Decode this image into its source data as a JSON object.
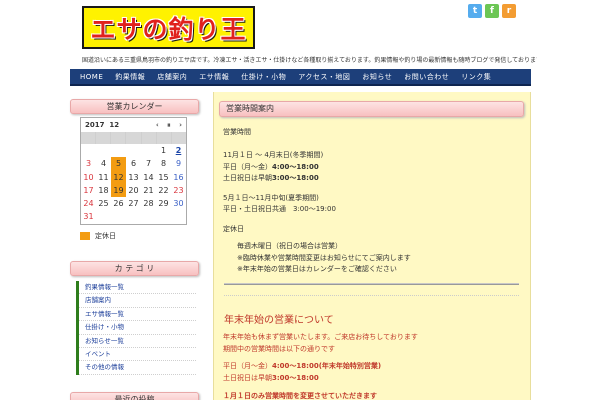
{
  "header": {
    "logo_text": "エサの釣り王",
    "description": "国道沿いにある三重県鳥羽市の釣りエサ店です。冷凍エサ・活きエサ・仕掛けなど各種取り揃えております。釣果情報や釣り場の最新情報も随時ブログで発信しておりますので、お気軽にご来店ください。営業時間や定休日はカレンダーでご確認いただけます。"
  },
  "social": {
    "twitter": "t",
    "feedly": "f",
    "rss": "r"
  },
  "nav": [
    "HOME",
    "釣果情報",
    "店舗案内",
    "エサ情報",
    "仕掛け・小物",
    "アクセス・地図",
    "お知らせ",
    "お問い合わせ",
    "リンク集"
  ],
  "sidebar": {
    "calendar_title": "営業カレンダー",
    "calendar": {
      "year": "2017",
      "month": "12",
      "prev": "‹",
      "today_btn": "⏸",
      "next": "›",
      "rows": [
        [
          "",
          "",
          "",
          "",
          "",
          "1",
          "2"
        ],
        [
          "3",
          "4",
          "5",
          "6",
          "7",
          "8",
          "9"
        ],
        [
          "10",
          "11",
          "12",
          "13",
          "14",
          "15",
          "16"
        ],
        [
          "17",
          "18",
          "19",
          "20",
          "21",
          "22",
          "23"
        ],
        [
          "24",
          "25",
          "26",
          "27",
          "28",
          "29",
          "30"
        ],
        [
          "31",
          "",
          "",
          "",
          "",
          "",
          ""
        ]
      ]
    },
    "legend": "定休日",
    "category_title": "カ テ ゴ リ",
    "categories": [
      "釣果情報一覧",
      "店舗案内",
      "エサ情報一覧",
      "仕掛け・小物",
      "お知らせ一覧",
      "イベント",
      "その他の情報"
    ],
    "next_title": "最近の投稿"
  },
  "main": {
    "title": "営業時間案内",
    "hours_label": "営業時間",
    "period1": "11月１日 ～ 4月末日(冬季期間)",
    "weekday1_a": "平日（月～金）",
    "weekday1_b": "4:00～18:00",
    "weekend1_a": "土日祝日は早朝",
    "weekend1_b": "3:00～18:00",
    "period2": "5月１日～11月中旬(夏季期間)",
    "weekday2": "平日・土日祝日共通　3:00～19:00",
    "closed_label": "定休日",
    "closed": "毎週木曜日（祝日の場合は営業）",
    "note1": "※臨時休業や営業時間変更はお知らせにてご案内します",
    "note2": "※年末年始の営業日はカレンダーをご確認ください",
    "section_title": "年末年始の営業について",
    "sec_line1": "年末年始も休まず営業いたします。ご来店お待ちしております",
    "sec_line2": "期間中の営業時間は以下の通りです",
    "sec_hours1_a": "平日（月～金）",
    "sec_hours1_b": "4:00～18:00(年末年始特別営業)",
    "sec_hours2_a": "土日祝日は早朝",
    "sec_hours2_b": "3:00～18:00",
    "sec_last": "１月１日のみ営業時間を変更させていただきます"
  }
}
